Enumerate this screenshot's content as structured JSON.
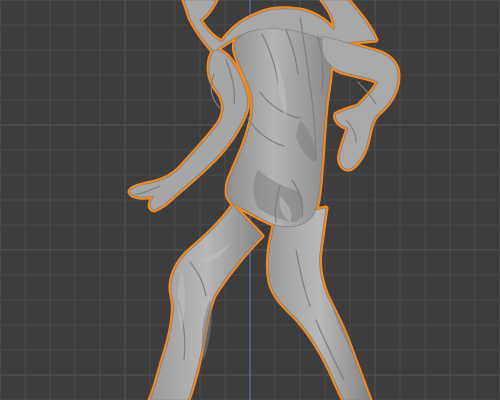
{
  "viewport": {
    "background_color": "#3d3d3d",
    "grid_color": "#4a4a4a",
    "grid_major_color": "#555555",
    "y_axis_color": "#5a7fc4",
    "selection_outline_color": "#f08a24",
    "mesh_color": "#a3a3a3",
    "mesh_shadow_color": "#7d7d7d",
    "mesh_highlight_color": "#c4c4c4"
  }
}
